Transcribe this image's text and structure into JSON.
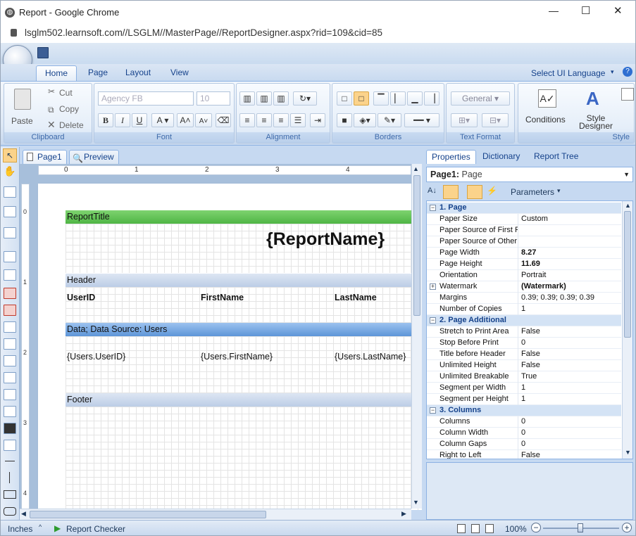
{
  "window": {
    "title": "Report - Google Chrome",
    "minimize": "—",
    "maximize": "☐",
    "close": "✕"
  },
  "address": {
    "url": "lsglm502.learnsoft.com//LSGLM//MasterPage//ReportDesigner.aspx?rid=109&cid=85"
  },
  "ribbon": {
    "tabs": [
      "Home",
      "Page",
      "Layout",
      "View"
    ],
    "active_tab": "Home",
    "language": "Select UI Language",
    "clipboard": {
      "label": "Clipboard",
      "paste": "Paste",
      "cut": "Cut",
      "copy": "Copy",
      "delete": "Delete"
    },
    "font": {
      "label": "Font",
      "family": "Agency FB",
      "size": "10",
      "bold": "B",
      "italic": "I",
      "underline": "U"
    },
    "alignment": {
      "label": "Alignment"
    },
    "borders": {
      "label": "Borders"
    },
    "text_format": {
      "label": "Text Format",
      "format": "General"
    },
    "style": {
      "label": "Style",
      "conditions": "Conditions",
      "style_designer": "Style Designer"
    }
  },
  "document": {
    "tabs": [
      "Page1",
      "Preview"
    ],
    "ruler_h": [
      "0",
      "1",
      "2",
      "3",
      "4"
    ],
    "ruler_v": [
      "0",
      "1",
      "2",
      "3",
      "4"
    ],
    "bands": {
      "report_title": "ReportTitle",
      "report_name": "{ReportName}",
      "header": "Header",
      "header_cols": [
        "UserID",
        "FirstName",
        "LastName"
      ],
      "data": "Data; Data Source: Users",
      "data_cols": [
        "{Users.UserID}",
        "{Users.FirstName}",
        "{Users.LastName}"
      ],
      "footer": "Footer"
    }
  },
  "properties": {
    "tabs": [
      "Properties",
      "Dictionary",
      "Report Tree"
    ],
    "object": "Page1:",
    "object_type": "Page",
    "parameters": "Parameters",
    "rows": [
      {
        "cat": true,
        "name": "1. Page"
      },
      {
        "name": "Paper Size",
        "value": "Custom"
      },
      {
        "name": "Paper Source of First P",
        "value": ""
      },
      {
        "name": "Paper Source of Other",
        "value": ""
      },
      {
        "name": "Page Width",
        "value": "8.27",
        "bold": true
      },
      {
        "name": "Page Height",
        "value": "11.69",
        "bold": true
      },
      {
        "name": "Orientation",
        "value": "Portrait"
      },
      {
        "name": "Watermark",
        "value": "(Watermark)",
        "bold": true,
        "expand": true
      },
      {
        "name": "Margins",
        "value": "0.39; 0.39; 0.39; 0.39"
      },
      {
        "name": "Number of Copies",
        "value": "1"
      },
      {
        "cat": true,
        "name": "2. Page Additional"
      },
      {
        "name": "Stretch to Print Area",
        "value": "False"
      },
      {
        "name": "Stop Before Print",
        "value": "0"
      },
      {
        "name": "Title before Header",
        "value": "False"
      },
      {
        "name": "Unlimited Height",
        "value": "False"
      },
      {
        "name": "Unlimited Breakable",
        "value": "True"
      },
      {
        "name": "Segment per Width",
        "value": "1"
      },
      {
        "name": "Segment per Height",
        "value": "1"
      },
      {
        "cat": true,
        "name": "3. Columns"
      },
      {
        "name": "Columns",
        "value": "0"
      },
      {
        "name": "Column Width",
        "value": "0"
      },
      {
        "name": "Column Gaps",
        "value": "0"
      },
      {
        "name": "Right to Left",
        "value": "False"
      }
    ]
  },
  "status": {
    "units": "Inches",
    "checker": "Report Checker",
    "zoom": "100%"
  },
  "colors": {
    "band_title": "#5ec454",
    "band_header": "#c7d5ea",
    "band_data": "#6da3e0",
    "accent": "#15428b"
  }
}
